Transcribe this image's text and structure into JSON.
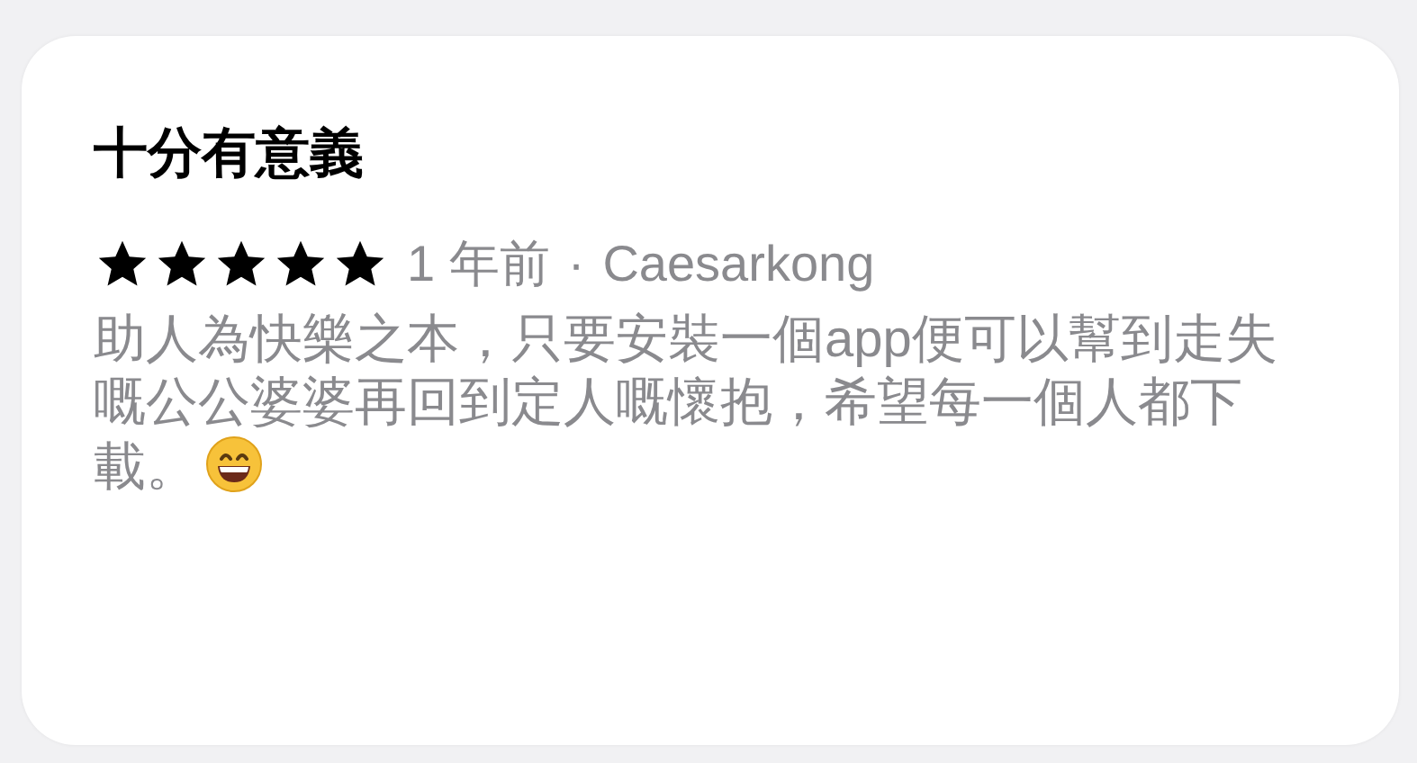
{
  "review": {
    "title": "十分有意義",
    "stars": 5,
    "date": "1 年前",
    "separator": "·",
    "author": "Caesarkong",
    "body": "助人為快樂之本，只要安裝一個app便可以幫到走失嘅公公婆婆再回到定人嘅懷抱，希望每一個人都下載。",
    "emoji": true
  }
}
